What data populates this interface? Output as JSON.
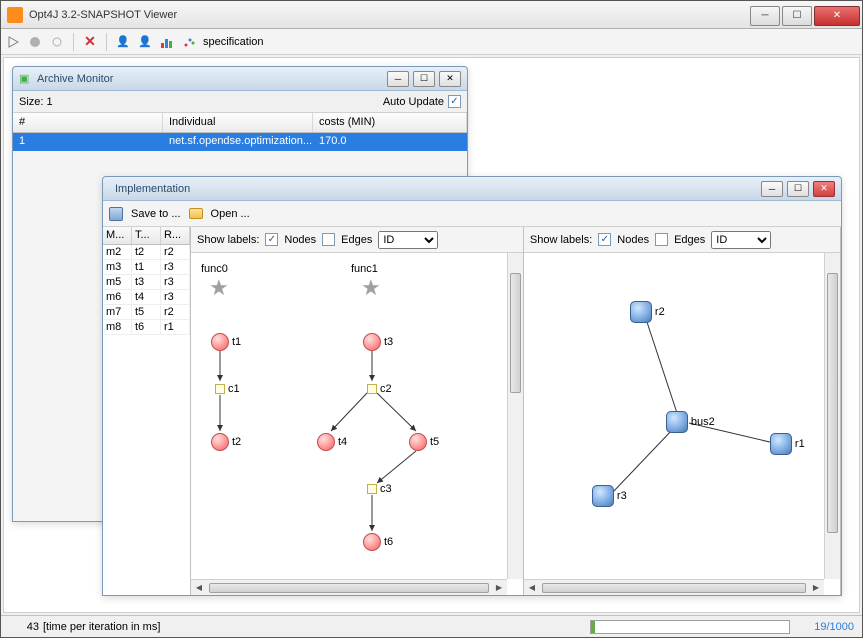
{
  "app": {
    "title": "Opt4J 3.2-SNAPSHOT Viewer"
  },
  "toolbar": {
    "specification_label": "specification"
  },
  "archive": {
    "title": "Archive Monitor",
    "size_label": "Size: 1",
    "auto_update_label": "Auto Update",
    "columns": {
      "num": "#",
      "individual": "Individual",
      "cost": "costs (MIN)"
    },
    "rows": [
      {
        "num": "1",
        "individual": "net.sf.opendse.optimization...",
        "cost": "170.0"
      }
    ]
  },
  "impl": {
    "title": "Implementation",
    "save_label": "Save to ...",
    "open_label": "Open ...",
    "side_cols": {
      "m": "M...",
      "t": "T...",
      "r": "R..."
    },
    "side_rows": [
      {
        "m": "m2",
        "t": "t2",
        "r": "r2"
      },
      {
        "m": "m3",
        "t": "t1",
        "r": "r3"
      },
      {
        "m": "m5",
        "t": "t3",
        "r": "r3"
      },
      {
        "m": "m6",
        "t": "t4",
        "r": "r3"
      },
      {
        "m": "m7",
        "t": "t5",
        "r": "r2"
      },
      {
        "m": "m8",
        "t": "t6",
        "r": "r1"
      }
    ],
    "show_labels": "Show labels:",
    "nodes_label": "Nodes",
    "edges_label": "Edges",
    "dropdown": "ID",
    "left_graph": {
      "funcs": [
        "func0",
        "func1"
      ],
      "tasks": [
        "t1",
        "t2",
        "t3",
        "t4",
        "t5",
        "t6"
      ],
      "comms": [
        "c1",
        "c2",
        "c3"
      ]
    },
    "right_graph": {
      "nodes": [
        "r1",
        "r2",
        "r3",
        "bus2"
      ]
    }
  },
  "status": {
    "time_value": "43",
    "time_label": "[time per iteration in ms]",
    "counter": "19/1000"
  }
}
